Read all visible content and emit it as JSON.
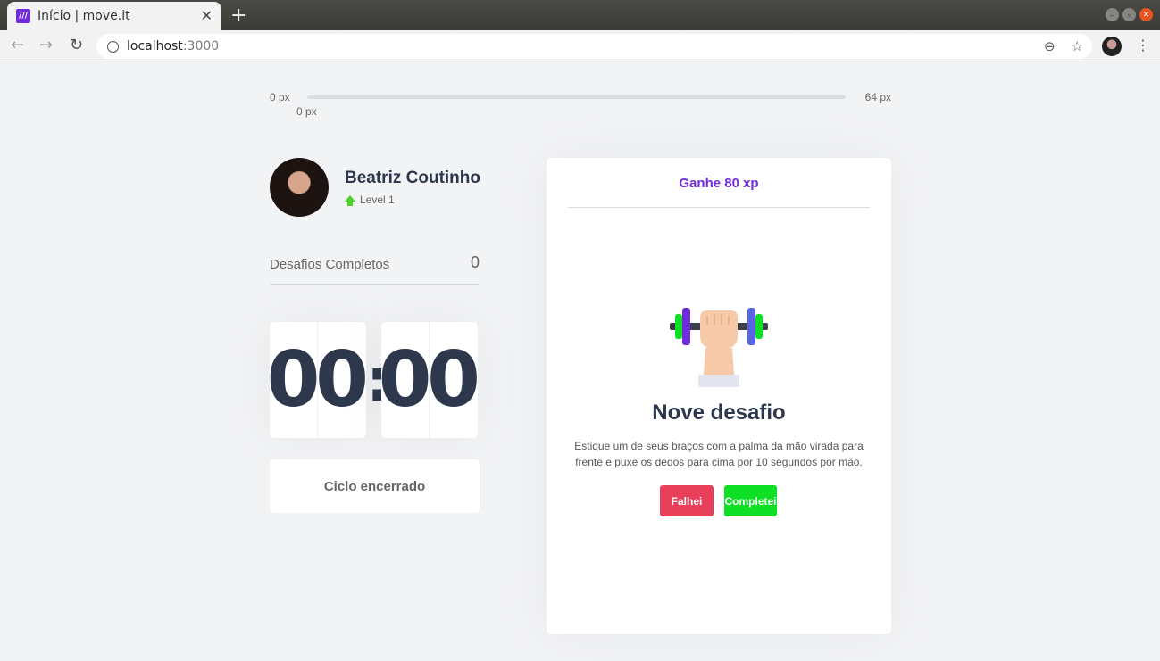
{
  "browser": {
    "tab_title": "Início | move.it",
    "favicon_text": "///",
    "url_host": "localhost",
    "url_port": ":3000"
  },
  "xp": {
    "min": "0 px",
    "max": "64 px",
    "current": "0 px",
    "progress_percent": 0
  },
  "profile": {
    "name": "Beatriz Coutinho",
    "level": "Level 1"
  },
  "completed": {
    "label": "Desafios Completos",
    "count": "0"
  },
  "countdown": {
    "min_tens": "0",
    "min_ones": "0",
    "colon": ":",
    "sec_tens": "0",
    "sec_ones": "0"
  },
  "cycle_button": {
    "label": "Ciclo encerrado"
  },
  "challenge": {
    "header": "Ganhe 80 xp",
    "title": "Nove desafio",
    "description": "Estique um de seus braços com a palma da mão virada para frente e puxe os dedos para cima por 10 segundos por mão.",
    "fail_label": "Falhei",
    "success_label": "Completei",
    "illustration": "dumbbell-hand-icon"
  },
  "colors": {
    "accent": "#6f2bdc",
    "fail": "#e83f5b",
    "success": "#0fe026",
    "level_up": "#4cd62b"
  }
}
